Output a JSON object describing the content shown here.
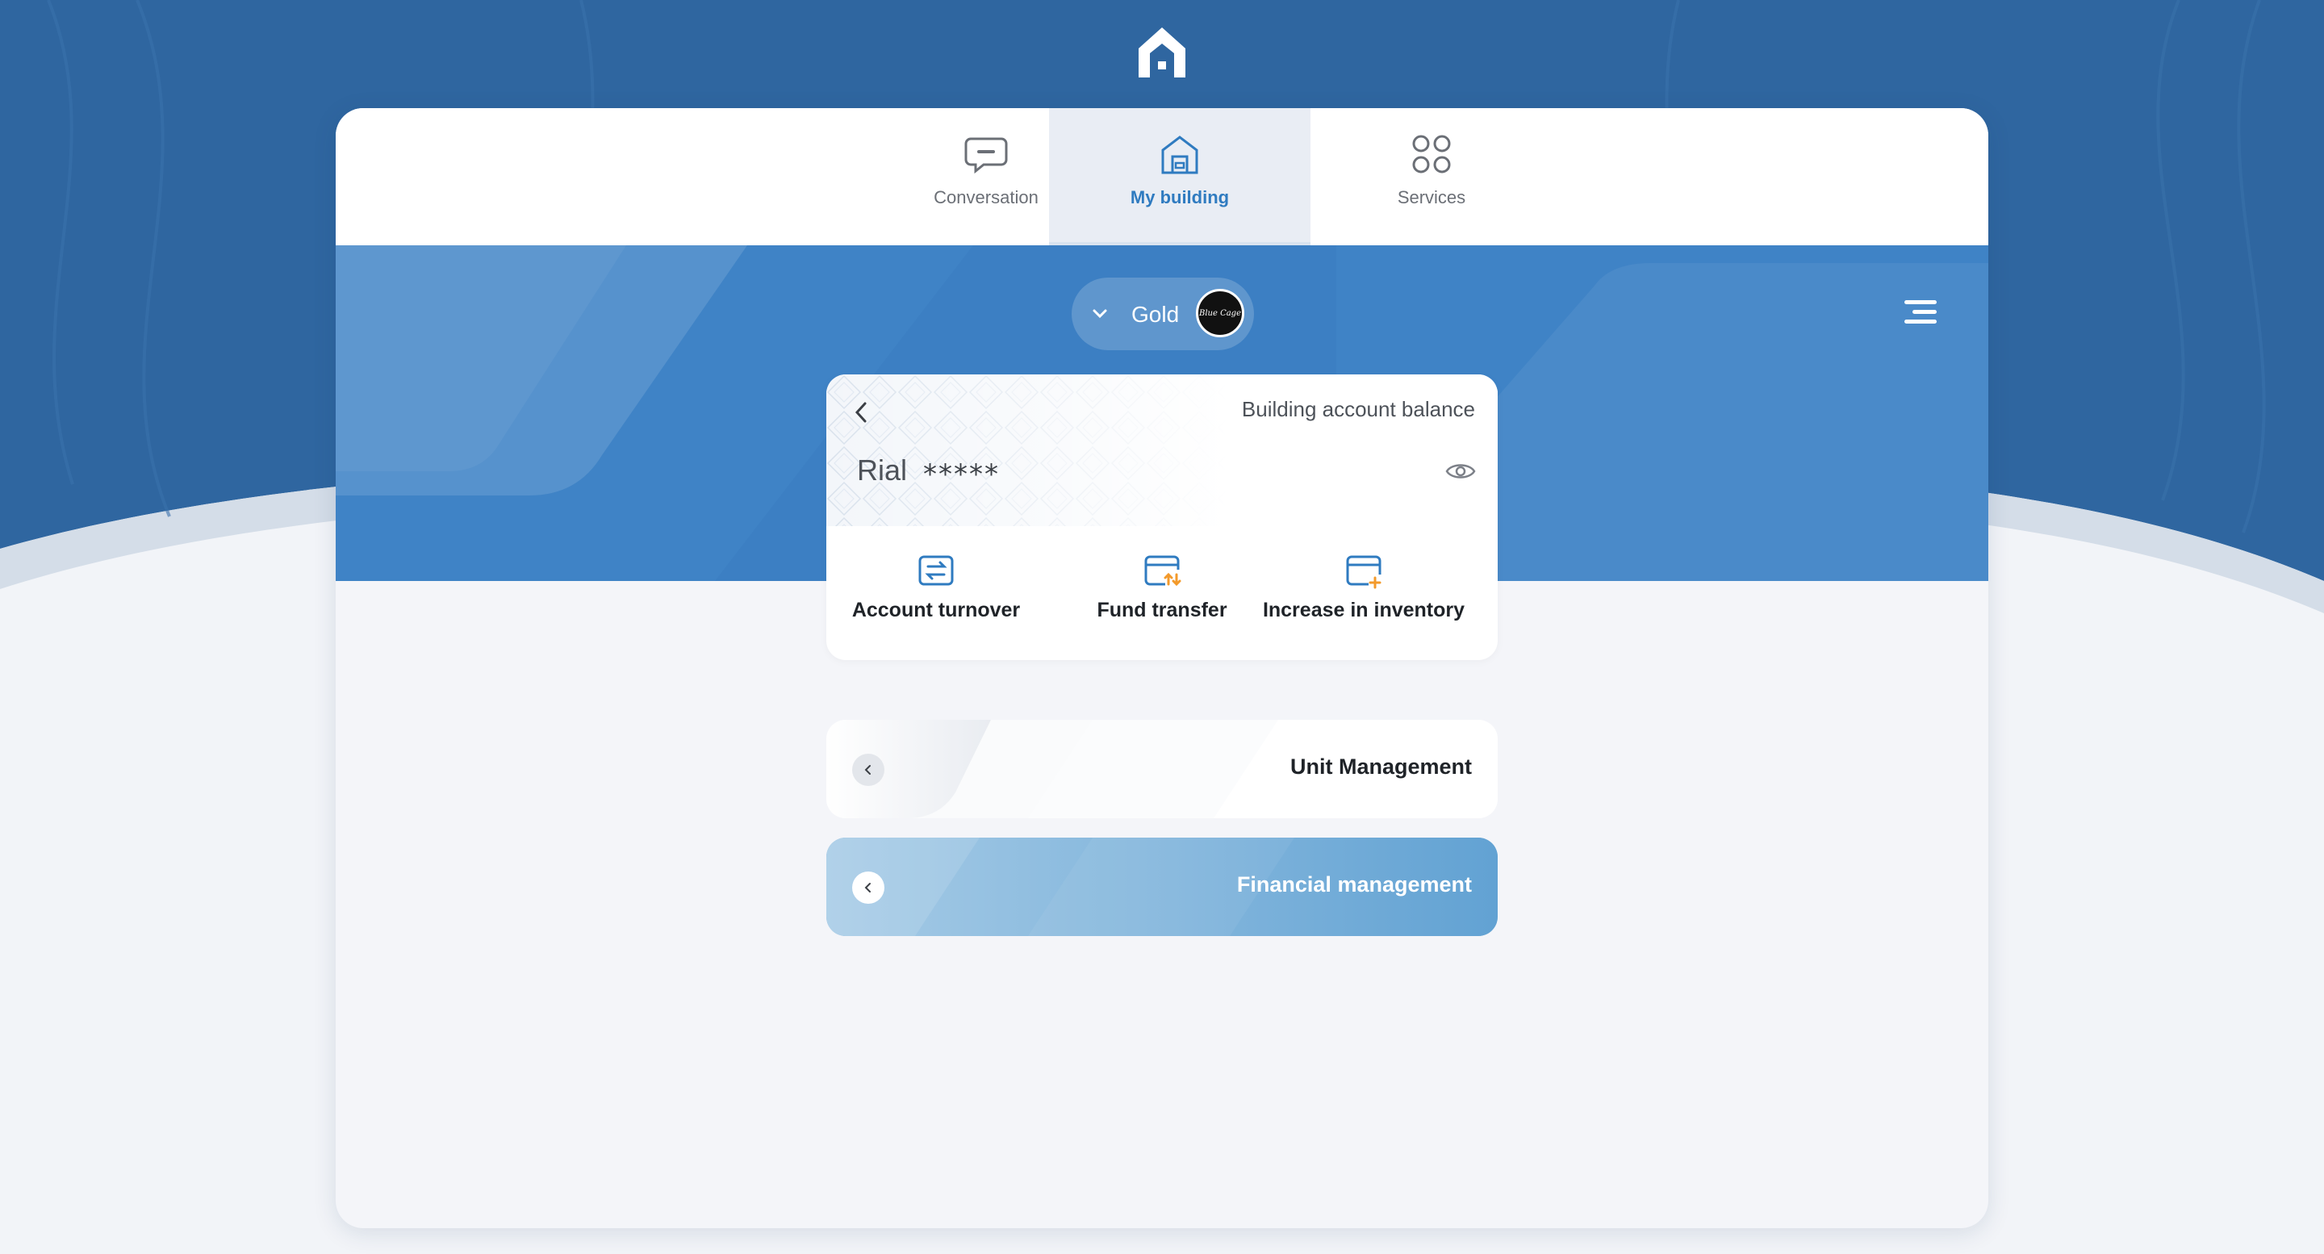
{
  "tabs": [
    {
      "label": "Conversation",
      "icon": "chat-icon",
      "active": false
    },
    {
      "label": "My building",
      "icon": "building-icon",
      "active": true
    },
    {
      "label": "Services",
      "icon": "grid-icon",
      "active": false
    }
  ],
  "selector": {
    "label": "Gold",
    "avatar_text": "Blue Cage"
  },
  "balance": {
    "title": "Building account balance",
    "currency": "Rial",
    "masked_amount": "*****"
  },
  "actions": [
    {
      "label": "Account turnover",
      "icon": "turnover-icon"
    },
    {
      "label": "Fund transfer",
      "icon": "fund-transfer-icon"
    },
    {
      "label": "Increase in inventory",
      "icon": "increase-inventory-icon"
    }
  ],
  "panels": [
    {
      "label": "Unit Management"
    },
    {
      "label": "Financial management"
    }
  ],
  "colors": {
    "brand_blue": "#3f83c6",
    "active_tab_text": "#2f7bc0",
    "accent_orange": "#f39a2b"
  }
}
